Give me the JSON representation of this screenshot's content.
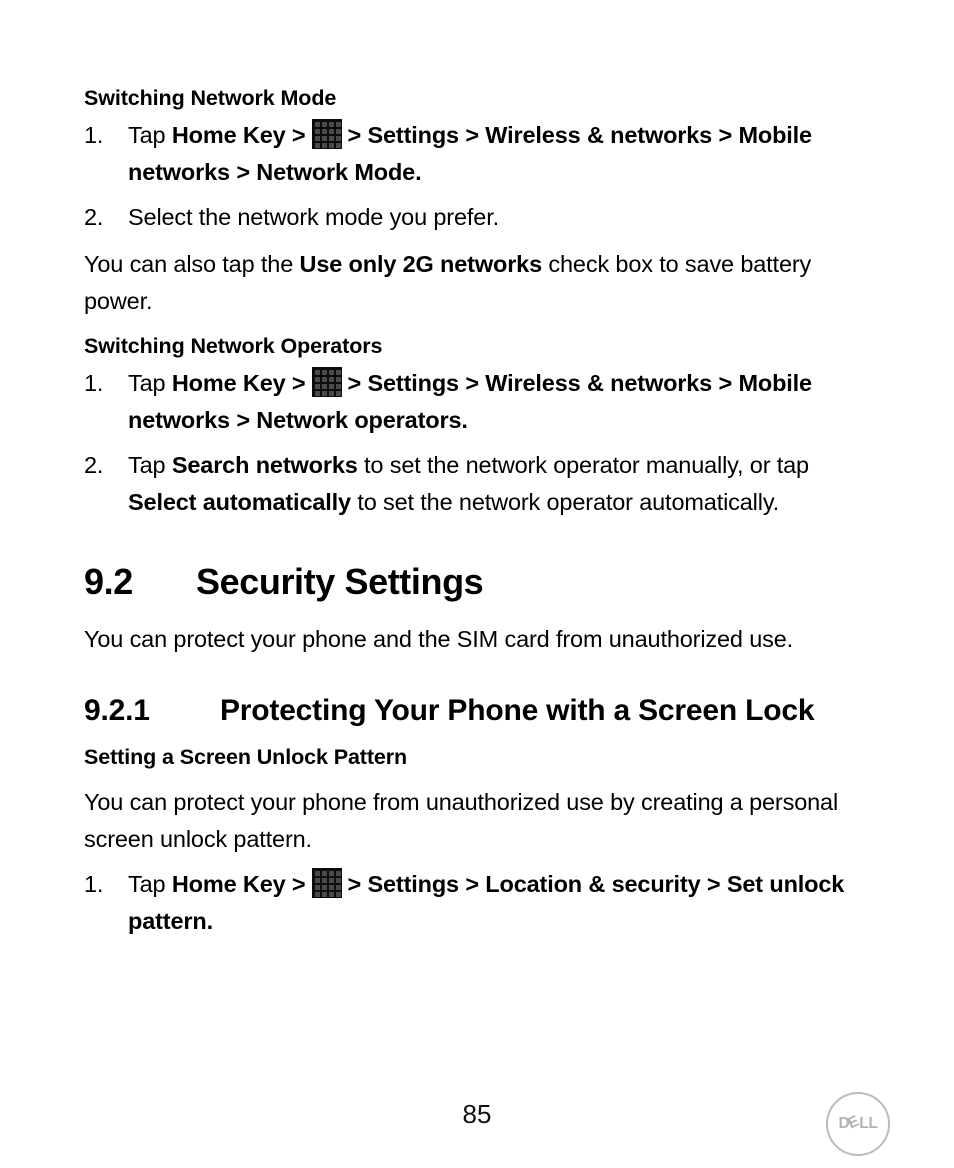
{
  "document": {
    "page_number": "85",
    "logo": {
      "brand": "DELL",
      "letters_before": "D",
      "letter_slanted": "E",
      "letters_after": "LL"
    }
  },
  "sections": [
    {
      "id": "switching-network-mode",
      "heading": "Switching Network Mode",
      "steps": [
        {
          "marker": "1.",
          "parts": [
            {
              "text": "Tap ",
              "bold": false
            },
            {
              "text": "Home Key >",
              "bold": true
            },
            {
              "icon": "app-drawer-grid-icon"
            },
            {
              "text": "> Settings > Wireless & networks > Mobile networks > Network Mode.",
              "bold": true
            }
          ]
        },
        {
          "marker": "2.",
          "parts": [
            {
              "text": "Select the network mode you prefer.",
              "bold": false
            }
          ]
        }
      ],
      "note_parts": [
        {
          "text": "You can also tap the ",
          "bold": false
        },
        {
          "text": "Use only 2G networks",
          "bold": true
        },
        {
          "text": " check box to save battery power.",
          "bold": false
        }
      ]
    },
    {
      "id": "switching-network-operators",
      "heading": "Switching Network Operators",
      "steps": [
        {
          "marker": "1.",
          "parts": [
            {
              "text": "Tap ",
              "bold": false
            },
            {
              "text": "Home Key >",
              "bold": true
            },
            {
              "icon": "app-drawer-grid-icon"
            },
            {
              "text": "> Settings > Wireless & networks > Mobile networks > Network operators.",
              "bold": true
            }
          ]
        },
        {
          "marker": "2.",
          "parts": [
            {
              "text": "Tap ",
              "bold": false
            },
            {
              "text": "Search networks",
              "bold": true
            },
            {
              "text": " to set the network operator manually, or tap ",
              "bold": false
            },
            {
              "text": "Select automatically",
              "bold": true
            },
            {
              "text": " to set the network operator automatically.",
              "bold": false
            }
          ]
        }
      ]
    }
  ],
  "chapter_section": {
    "number": "9.2",
    "title": "Security Settings",
    "intro": "You can protect your phone and the SIM card from unauthorized use."
  },
  "subsection": {
    "number": "9.2.1",
    "title_line_1": "Protecting Your Phone with a Screen",
    "title_line_2": "Lock",
    "heading": "Setting a Screen Unlock Pattern",
    "intro": "You can protect your phone from unauthorized use by creating a personal screen unlock pattern.",
    "steps": [
      {
        "marker": "1.",
        "parts": [
          {
            "text": "Tap ",
            "bold": false
          },
          {
            "text": "Home Key >",
            "bold": true
          },
          {
            "icon": "app-drawer-grid-icon"
          },
          {
            "text": "> Settings > Location & security > Set unlock pattern.",
            "bold": true
          }
        ]
      }
    ]
  },
  "text": {
    "s0_heading": "Switching Network Mode",
    "s0_step1_tap": "Tap ",
    "s0_step1_homekey": "Home Key >",
    "s0_step1_rest": "> Settings > Wireless & networks > Mobile networks > Network Mode.",
    "s0_step1_marker": "1.",
    "s0_step2_marker": "2.",
    "s0_step2_text": "Select the network mode you prefer.",
    "s0_note_a": "You can also tap the ",
    "s0_note_b": "Use only 2G networks",
    "s0_note_c": " check box to save battery power.",
    "s1_heading": "Switching Network Operators",
    "s1_step1_marker": "1.",
    "s1_step1_tap": "Tap ",
    "s1_step1_homekey": "Home Key >",
    "s1_step1_rest": "> Settings > Wireless & networks > Mobile networks > Network operators.",
    "s1_step2_marker": "2.",
    "s1_step2_a": "Tap ",
    "s1_step2_b": "Search networks",
    "s1_step2_c": " to set the network operator manually, or tap ",
    "s1_step2_d": "Select automatically",
    "s1_step2_e": " to set the network operator automatically.",
    "h2_num": "9.2",
    "h2_title": "Security Settings",
    "h2_intro": "You can protect your phone and the SIM card from unauthorized use.",
    "h3_num": "9.2.1",
    "h3_title_1": "Protecting Your Phone with a Screen",
    "h3_title_2": "Lock",
    "s2_heading": "Setting a Screen Unlock Pattern",
    "s2_intro": "You can protect your phone from unauthorized use by creating a personal screen unlock pattern.",
    "s2_step1_marker": "1.",
    "s2_step1_tap": "Tap ",
    "s2_step1_homekey": "Home Key >",
    "s2_step1_rest": "> Settings > Location & security > Set unlock pattern.",
    "page_number": "85",
    "logo_d": "D",
    "logo_e": "E",
    "logo_ll": "LL"
  }
}
